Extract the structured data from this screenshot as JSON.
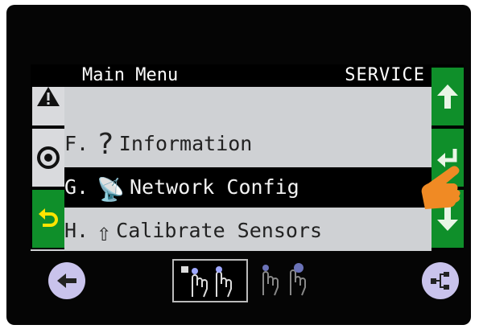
{
  "header": {
    "title": "Main Menu",
    "mode": "SERVICE"
  },
  "menu_items": [
    {
      "label": "F.",
      "icon": "question-mark-icon",
      "glyph": "?",
      "text": "Information",
      "selected": false
    },
    {
      "label": "G.",
      "icon": "satellite-dish-icon",
      "glyph": "📡",
      "text": "Network Config",
      "selected": true
    },
    {
      "label": "H.",
      "icon": "arrow-up-circle-icon",
      "glyph": "⇧",
      "text": "Calibrate Sensors",
      "selected": false
    }
  ],
  "left_buttons": [
    {
      "icon": "warning-icon",
      "style": "white"
    },
    {
      "icon": "stop-circle-icon",
      "style": "white"
    },
    {
      "icon": "undo-icon",
      "style": "green"
    }
  ],
  "right_buttons": [
    {
      "icon": "arrow-up-icon",
      "style": "green"
    },
    {
      "icon": "enter-return-icon",
      "style": "green"
    },
    {
      "icon": "arrow-down-icon",
      "style": "green"
    }
  ],
  "bottom": {
    "back_icon": "arrow-left-icon",
    "gesture_icons": [
      "two-finger-lock-gesture-icon",
      "two-finger-tap-gesture-icon"
    ],
    "network_icon": "network-tree-icon"
  },
  "colors": {
    "accent_green": "#0f8f2a",
    "screen_bg": "#cfd1d4",
    "round_button": "#c9c3ec",
    "finger": "#f08a24"
  }
}
